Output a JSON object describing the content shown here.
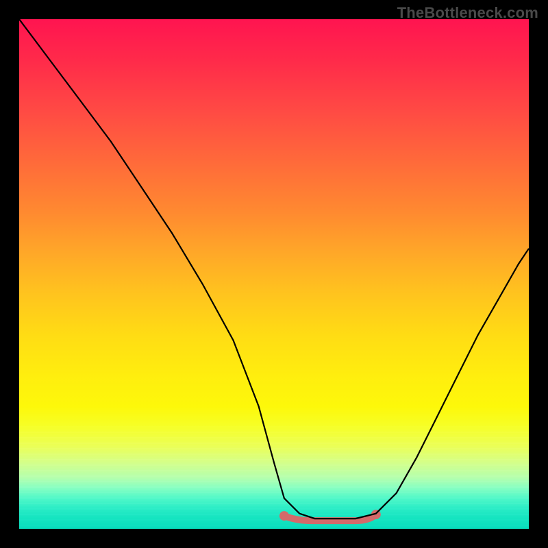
{
  "watermark": "TheBottleneck.com",
  "chart_data": {
    "type": "line",
    "title": "",
    "xlabel": "",
    "ylabel": "",
    "xlim": [
      0,
      100
    ],
    "ylim": [
      0,
      100
    ],
    "series": [
      {
        "name": "curve",
        "x": [
          0,
          6,
          12,
          18,
          24,
          30,
          36,
          42,
          47,
          50,
          52,
          55,
          58,
          62,
          66,
          70,
          74,
          78,
          82,
          86,
          90,
          94,
          98,
          100
        ],
        "y": [
          100,
          92,
          84,
          76,
          67,
          58,
          48,
          37,
          24,
          13,
          6,
          3,
          2,
          2,
          2,
          3,
          7,
          14,
          22,
          30,
          38,
          45,
          52,
          55
        ]
      }
    ],
    "flat_region": {
      "x_start": 52,
      "x_end": 70,
      "y": 2
    }
  }
}
